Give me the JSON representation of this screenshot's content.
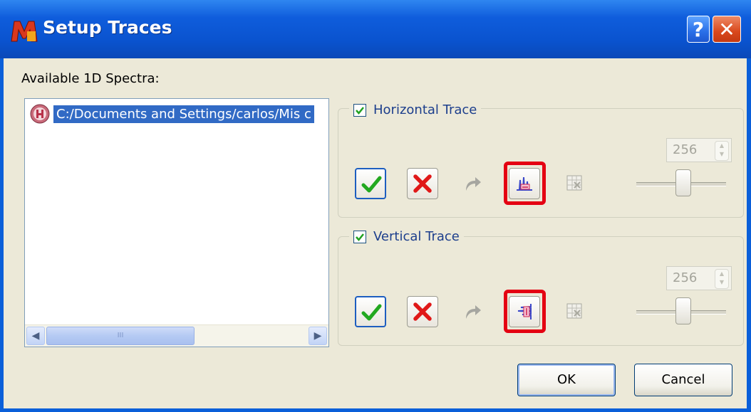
{
  "window": {
    "title": "Setup Traces",
    "help_glyph": "?",
    "close_glyph": "✕"
  },
  "spectra": {
    "label": "Available 1D Spectra:",
    "items": [
      {
        "text": "C:/Documents and Settings/carlos/Mis c",
        "selected": true
      }
    ],
    "scroll": {
      "left_glyph": "◀",
      "right_glyph": "▶",
      "grip": "III"
    }
  },
  "horizontal_trace": {
    "label": "Horizontal Trace",
    "checked": true,
    "spin_value": "256"
  },
  "vertical_trace": {
    "label": "Vertical Trace",
    "checked": true,
    "spin_value": "256"
  },
  "buttons": {
    "ok": "OK",
    "cancel": "Cancel"
  },
  "colors": {
    "titlebar": "#0a53cf",
    "highlight": "#e40012",
    "selection": "#316ac5",
    "dialog_bg": "#ece9d8"
  },
  "icons": [
    "app-logo-icon",
    "help-icon",
    "close-icon",
    "spectrum-file-icon",
    "check-icon",
    "x-icon",
    "redo-arrow-icon",
    "horizontal-trace-icon",
    "vertical-trace-icon",
    "table-delete-icon"
  ]
}
